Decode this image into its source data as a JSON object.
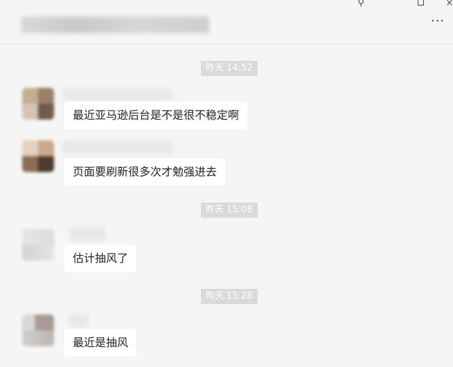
{
  "window": {
    "pin_icon": "⚲",
    "close_icon": "×",
    "more_icon": "···"
  },
  "messages": [
    {
      "timestamp": "昨天 14:52",
      "text": "最近亚马逊后台是不是很不稳定啊"
    },
    {
      "timestamp": "",
      "text": "页面要刷新很多次才勉强进去"
    },
    {
      "timestamp": "昨天 15:08",
      "text": "估计抽风了"
    },
    {
      "timestamp": "昨天 15:28",
      "text": "最近是抽风"
    }
  ],
  "colors": {
    "background": "#f5f5f5",
    "bubble": "#ffffff",
    "timestamp_bg": "#dadada",
    "timestamp_text": "#ffffff"
  }
}
